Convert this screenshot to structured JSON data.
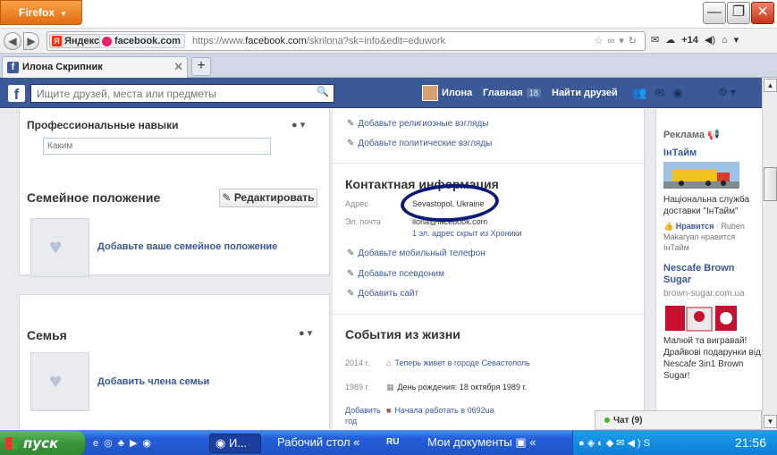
{
  "browser": {
    "menu_label": "Firefox",
    "window_controls": {
      "minimize": "—",
      "maximize": "❐",
      "close": "✕"
    },
    "yandex_label": "Яндекс",
    "site_identity": "facebook.com",
    "url_prefix": "https://www.",
    "url_domain": "facebook.com",
    "url_rest": "/skrilona?sk=info&edit=eduwork",
    "toolbar_badge": "+14",
    "tab_title": "Илона Скрипник",
    "new_tab_label": "+"
  },
  "facebook": {
    "search_placeholder": "Ищите друзей, места или предметы",
    "user_name": "Илона",
    "home_label": "Главная",
    "home_count": "18",
    "find_friends_label": "Найти друзей"
  },
  "left": {
    "skills_title": "Профессиональные навыки",
    "skills_input_placeholder": "Каким",
    "family_status_title": "Семейное положение",
    "edit_button": "Редактировать",
    "add_family_status": "Добавьте ваше семейное положение",
    "family_title": "Семья",
    "add_family_member": "Добавить члена семьи"
  },
  "middle": {
    "links_top": [
      "Добавьте религиозные взгляды",
      "Добавьте политические взгляды"
    ],
    "contact_title": "Контактная информация",
    "address_label": "Адрес",
    "address_value": "Sevastopol, Ukraine",
    "email_label": "Эл. почта",
    "email_value": "ilona@facebook.com",
    "email_hidden_note": "1 эл. адрес скрыт из Хроники",
    "contact_links": [
      "Добавьте мобильный телефон",
      "Добавьте псевдоним",
      "Добавить сайт"
    ],
    "life_events_title": "События из жизни",
    "events": [
      {
        "year": "2014 г.",
        "text": "Теперь живет в городе Севастополь"
      },
      {
        "year": "1989 г.",
        "text": "День рождения: 18 октября 1989 г."
      },
      {
        "year": "Добавить год",
        "text": "Начала работать в 0692ua"
      }
    ]
  },
  "ads": {
    "title": "Реклама",
    "ad1": {
      "head": "ІнТайм",
      "text": "Національна служба доставки \"ІнТайм\"",
      "like": "Нравится",
      "meta": "· Ruben Makaryan нравится ІнТайм"
    },
    "ad2": {
      "head": "Nescafe Brown Sugar",
      "url": "brown-sugar.com.ua",
      "text": "Малюй та вигравай! Драйвові подарунки від Nescafe 3in1 Brown Sugar!"
    }
  },
  "chat": {
    "label": "Чат (9)"
  },
  "taskbar": {
    "start_label": "пуск",
    "active_task": "И...",
    "desktop_task": "Рабочий стол",
    "lang": "RU",
    "docs_task": "Мои документы",
    "clock": "21:56"
  },
  "colors": {
    "facebook_blue": "#3b5998",
    "annotation_circle": "#0a1a78",
    "taskbar_blue": "#245edb",
    "start_green": "#3a953a"
  }
}
